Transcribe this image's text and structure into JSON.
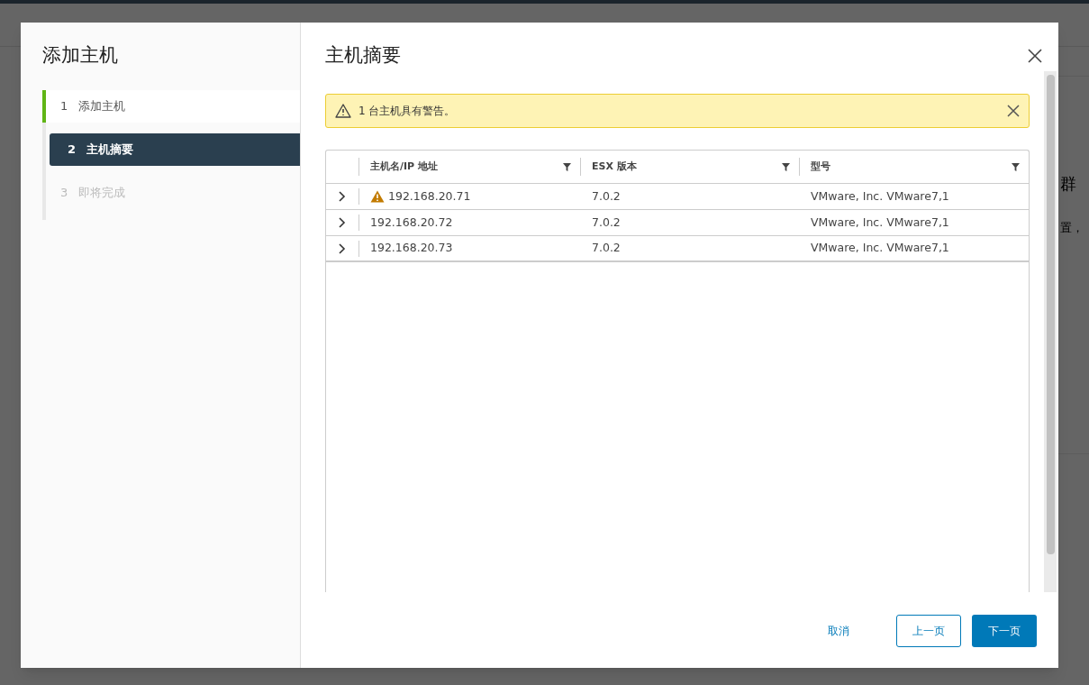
{
  "background": {
    "fragments": [
      "群",
      "置，"
    ]
  },
  "dialog": {
    "sidebar": {
      "title": "添加主机",
      "steps": [
        {
          "number": "1",
          "label": "添加主机",
          "completed": true,
          "selected": false,
          "disabled": false
        },
        {
          "number": "2",
          "label": "主机摘要",
          "completed": false,
          "selected": true,
          "disabled": false
        },
        {
          "number": "3",
          "label": "即将完成",
          "completed": false,
          "selected": false,
          "disabled": true
        }
      ]
    },
    "title": "主机摘要",
    "alert": {
      "text": "1 台主机具有警告。"
    },
    "table": {
      "columns": [
        "主机名/IP 地址",
        "ESX 版本",
        "型号"
      ],
      "rows": [
        {
          "expanded": false,
          "warning": true,
          "cells": [
            "192.168.20.71",
            "7.0.2",
            "VMware, Inc. VMware7,1"
          ]
        },
        {
          "expanded": false,
          "warning": false,
          "cells": [
            "192.168.20.72",
            "7.0.2",
            "VMware, Inc. VMware7,1"
          ]
        },
        {
          "expanded": false,
          "warning": false,
          "cells": [
            "192.168.20.73",
            "7.0.2",
            "VMware, Inc. VMware7,1"
          ]
        }
      ]
    },
    "buttons": {
      "cancel": "取消",
      "back": "上一页",
      "next": "下一页"
    }
  }
}
